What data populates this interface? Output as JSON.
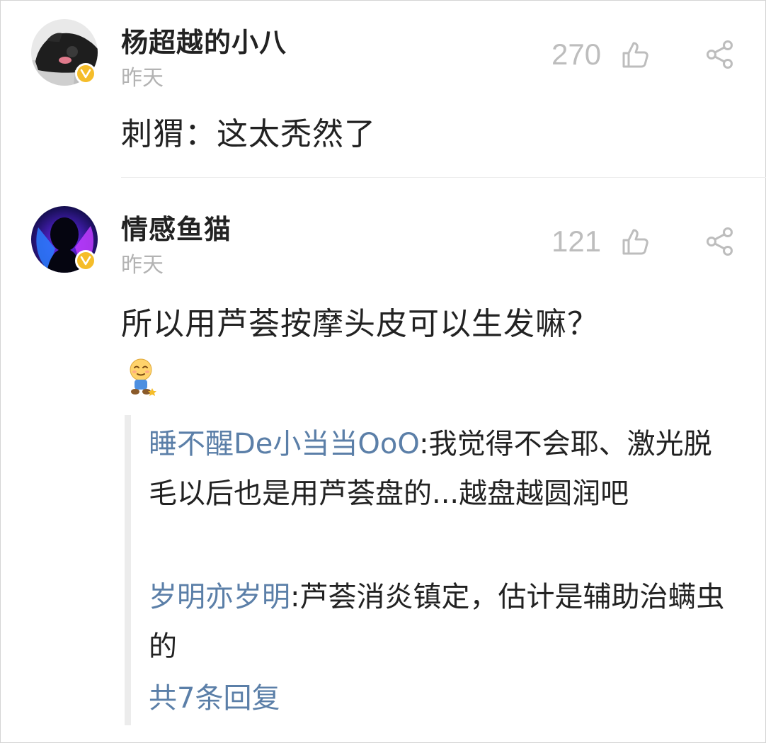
{
  "comments": [
    {
      "username": "杨超越的小八",
      "time": "昨天",
      "likes": "270",
      "text": "刺猬：这太秃然了",
      "verified_badge": "V"
    },
    {
      "username": "情感鱼猫",
      "time": "昨天",
      "likes": "121",
      "text": "所以用芦荟按摩头皮可以生发嘛？",
      "verified_badge": "V",
      "replies": [
        {
          "user": "睡不醒De小当当OoO",
          "text": ":我觉得不会耶、激光脱毛以后也是用芦荟盘的...越盘越圆润吧"
        },
        {
          "user": "岁明亦岁明",
          "text": ":芦荟消炎镇定，估计是辅助治螨虫的"
        }
      ],
      "more_replies": "共7条回复"
    }
  ],
  "icons": {
    "like": "thumbs-up-icon",
    "share": "share-icon",
    "badge": "verified-badge-icon"
  },
  "colors": {
    "link": "#5b7fa8",
    "badge": "#f5bd2a",
    "muted": "#bdbdbd"
  }
}
